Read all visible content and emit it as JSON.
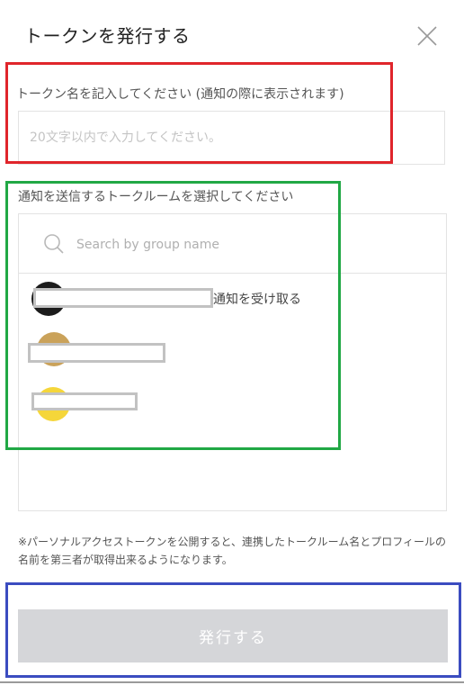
{
  "dialog": {
    "title": "トークンを発行する",
    "close_icon": "close-icon"
  },
  "token_name": {
    "label": "トークン名を記入してください (通知の際に表示されます)",
    "placeholder": "20文字以内で入力してください。",
    "value": ""
  },
  "room_select": {
    "label": "通知を送信するトークルームを選択してください",
    "search_placeholder": "Search by group name",
    "search_icon": "search-icon",
    "rooms": [
      {
        "avatar_color": "#1c1c1c",
        "name": "",
        "badge": "通知を受け取る"
      },
      {
        "avatar_color": "#caa25a",
        "name": ""
      },
      {
        "avatar_color": "#f5d63a",
        "name": ""
      }
    ]
  },
  "notice": "※パーソナルアクセストークンを公開すると、連携したトークルーム名とプロフィールの名前を第三者が取得出来るようになります。",
  "issue_button": {
    "label": "発行する",
    "enabled": false
  },
  "colors": {
    "highlight_red": "#e0252b",
    "highlight_green": "#21a845",
    "highlight_blue": "#3b4cc0",
    "button_disabled": "#d5d6d9"
  }
}
